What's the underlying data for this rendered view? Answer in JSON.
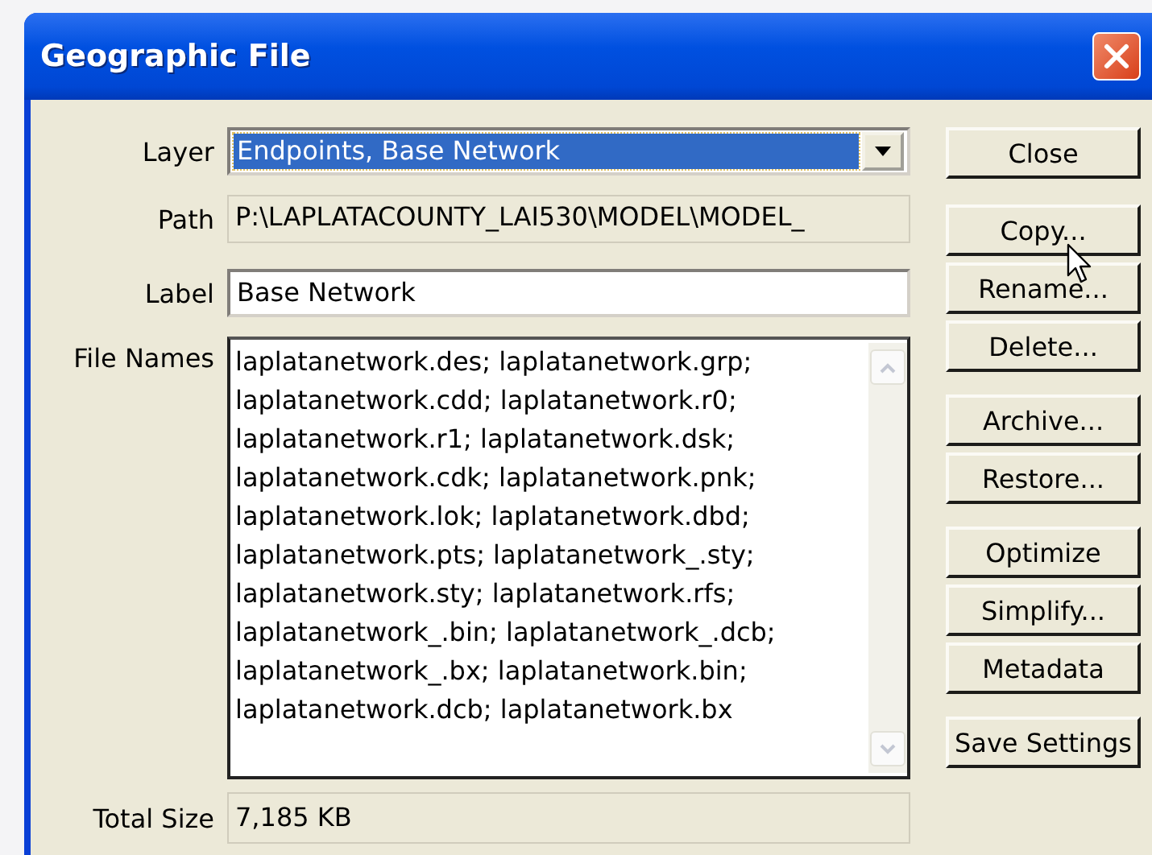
{
  "window": {
    "title": "Geographic File"
  },
  "fields": [
    {
      "label": "Layer",
      "kind": "dropdown",
      "value": "Endpoints, Base Network",
      "focused": true
    },
    {
      "label": "Path",
      "kind": "readonly",
      "value": "P:\\LAPLATACOUNTY_LAI530\\MODEL\\MODEL_"
    },
    {
      "label": "Label",
      "kind": "text",
      "value": "Base Network"
    }
  ],
  "file_names": {
    "label": "File Names",
    "lines": [
      "laplatanetwork.des; laplatanetwork.grp;",
      "laplatanetwork.cdd; laplatanetwork.r0;",
      "laplatanetwork.r1; laplatanetwork.dsk;",
      "laplatanetwork.cdk; laplatanetwork.pnk;",
      "laplatanetwork.lok; laplatanetwork.dbd;",
      "laplatanetwork.pts; laplatanetwork_.sty;",
      "laplatanetwork.sty; laplatanetwork.rfs;",
      "laplatanetwork_.bin; laplatanetwork_.dcb;",
      "laplatanetwork_.bx; laplatanetwork.bin;",
      "laplatanetwork.dcb; laplatanetwork.bx"
    ]
  },
  "total_size": {
    "label": "Total Size",
    "value": "7,185 KB"
  },
  "button_groups": [
    [
      "Close"
    ],
    [
      "Copy...",
      "Rename...",
      "Delete..."
    ],
    [
      "Archive...",
      "Restore..."
    ],
    [
      "Optimize",
      "Simplify...",
      "Metadata"
    ],
    [
      "Save Settings"
    ]
  ]
}
